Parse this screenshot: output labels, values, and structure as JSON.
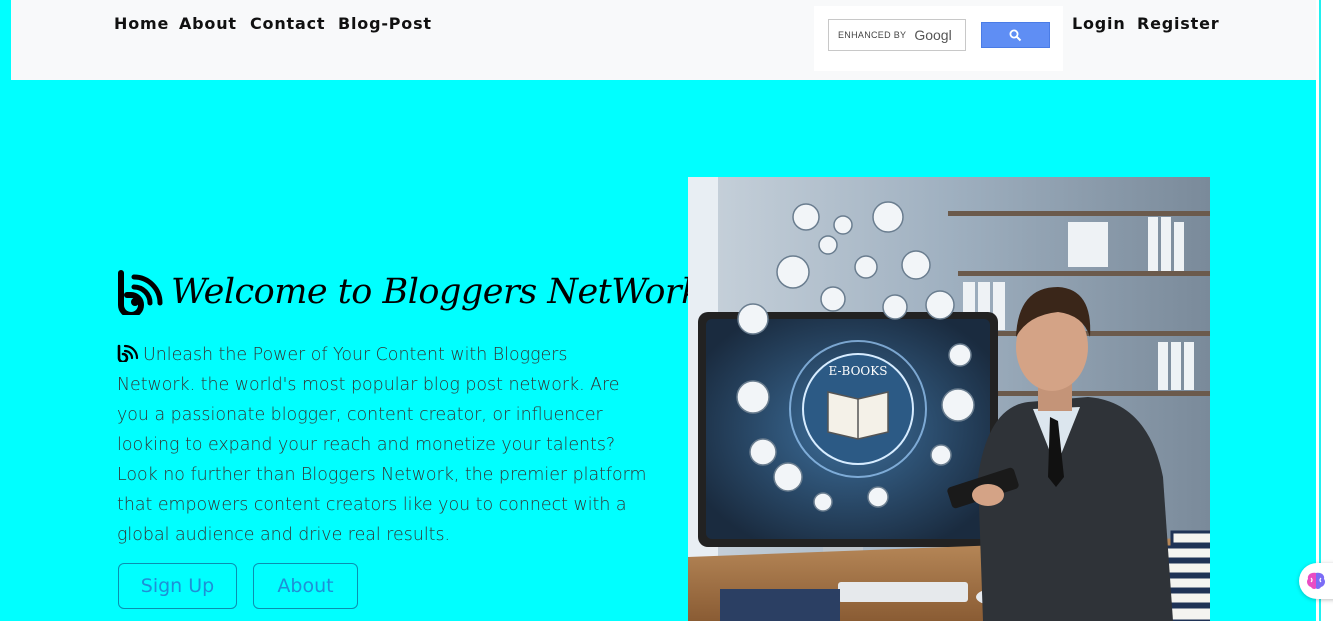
{
  "nav": {
    "links": [
      "Home",
      "About",
      "Contact",
      "Blog-Post"
    ],
    "auth": [
      "Login",
      "Register"
    ]
  },
  "search": {
    "enhanced_by": "ENHANCED BY",
    "brand": "Googl",
    "icon": "search-icon"
  },
  "hero": {
    "title": "Welcome to Bloggers NetWork",
    "logo_icon": "blogger-logo-icon",
    "body": "Unleash the Power of Your Content with Bloggers Network. the world's most popular blog post network. Are you a passionate blogger, content creator, or influencer looking to expand your reach and monetize your talents? Look no further than Bloggers Network, the premier platform that empowers content creators like you to connect with a global audience and drive real results.",
    "buttons": {
      "signup": "Sign Up",
      "about": "About"
    },
    "image_icon_label": "E-BOOKS"
  },
  "widget": {
    "icon": "brain-icon"
  },
  "colors": {
    "background": "#00ffff",
    "navbar": "#f8f9fa",
    "button_border": "#0b8fb0",
    "button_text": "#1e90d6",
    "search_button": "#5f8ef4"
  }
}
